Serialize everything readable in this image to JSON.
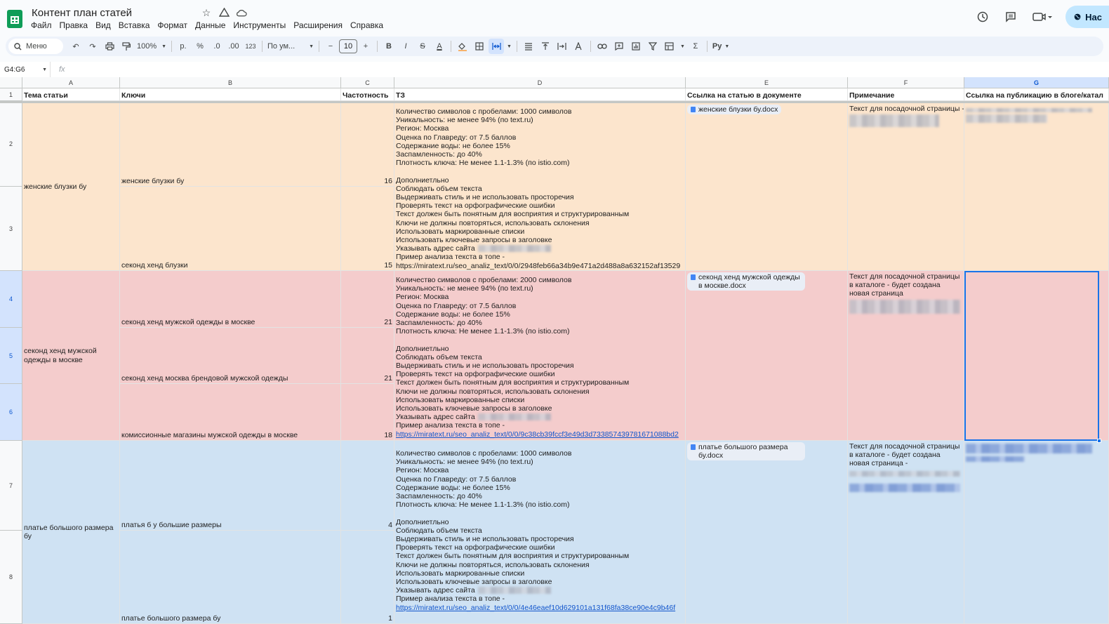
{
  "app": {
    "title": "Контент план статей",
    "menu": [
      "Файл",
      "Правка",
      "Вид",
      "Вставка",
      "Формат",
      "Данные",
      "Инструменты",
      "Расширения",
      "Справка"
    ],
    "share_label": "Нас"
  },
  "toolbar": {
    "search_label": "Меню",
    "zoom": "100%",
    "currency": "р.",
    "percent": "%",
    "dec_decrease": ".0",
    "dec_increase": ".00",
    "number_format": "123",
    "font": "По ум...",
    "font_size": "10",
    "bold": "B",
    "italic": "I",
    "strike": "S",
    "text_color": "A",
    "sum": "Σ",
    "input_tools": "Ру"
  },
  "formula": {
    "namebox": "G4:G6",
    "fx": "fx"
  },
  "columns": [
    "A",
    "B",
    "C",
    "D",
    "E",
    "F",
    "G"
  ],
  "rows": [
    "1",
    "2",
    "3",
    "4",
    "5",
    "6",
    "7",
    "8"
  ],
  "header_row": {
    "a": "Тема статьи",
    "b": "Ключи",
    "c": "Частотность",
    "d": "ТЗ",
    "e": "Ссылка на статью в документе",
    "f": "Примечание",
    "g": "Ссылка на публикацию в блоге/катал"
  },
  "groups": [
    {
      "topic": "женские блузки бу",
      "keys": [
        {
          "key": "женские блузки бу",
          "freq": "16"
        },
        {
          "key": "секонд хенд блузки",
          "freq": "15"
        }
      ],
      "tz": [
        "Количество символов с пробелами: 1000 символов",
        "Уникальность: не менее 94% (по text.ru)",
        "Регион: Москва",
        "Оценка по Главреду: от 7.5 баллов",
        "Содержание воды: не более 15%",
        "Заспамленность: до 40%",
        "Плотность ключа: Не менее 1.1-1.3% (по istio.com)",
        "",
        "Дополниетльно",
        "Соблюдать объем текста",
        "Выдерживать стиль и не использовать просторечия",
        "Проверять текст на орфографические ошибки",
        "Текст должен быть понятным для восприятия и структурированным",
        "Ключи не должны повторяться, использовать склонения",
        "Использовать маркированные списки",
        "Использовать ключевые запросы в заголовке",
        "Указывать адрес сайта",
        "Пример анализа текста в топе -"
      ],
      "tz_link": "https://miratext.ru/seo_analiz_text/0/0/2948feb66a34b9e471a2d488a8a632152af13529",
      "doc": "женские блузки бу.docx",
      "note": "Текст для посадочной страницы -"
    },
    {
      "topic": "секонд хенд мужской одежды в москве",
      "keys": [
        {
          "key": "секонд хенд мужской одежды в москве",
          "freq": "21"
        },
        {
          "key": "секонд хенд москва брендовой мужской одежды",
          "freq": "21"
        },
        {
          "key": "комиссионные магазины мужской одежды в москве",
          "freq": "18"
        }
      ],
      "tz": [
        "Количество символов с пробелами: 2000 символов",
        "Уникальность: не менее 94% (по text.ru)",
        "Регион: Москва",
        "Оценка по Главреду: от 7.5 баллов",
        "Содержание воды: не более 15%",
        "Заспамленность: до 40%",
        "Плотность ключа: Не менее 1.1-1.3% (по istio.com)",
        "",
        "Дополниетльно",
        "Соблюдать объем текста",
        "Выдерживать стиль и не использовать просторечия",
        "Проверять текст на орфографические ошибки",
        "Текст должен быть понятным для восприятия и структурированным",
        "Ключи не должны повторяться, использовать склонения",
        "Использовать маркированные списки",
        "Использовать ключевые запросы в заголовке",
        "Указывать адрес сайта",
        "Пример анализа текста в топе -"
      ],
      "tz_link": "https://miratext.ru/seo_analiz_text/0/0/9c38cb39fccf3e49d3d733857439781671088bd2",
      "doc": "секонд хенд мужской одежды в москве.docx",
      "note": "Текст для посадочной страницы в каталоге - будет создана новая страница"
    },
    {
      "topic": "платье большого размера бу",
      "keys": [
        {
          "key": "платья б у большие размеры",
          "freq": "4"
        },
        {
          "key": "платье большого размера бу",
          "freq": "1"
        }
      ],
      "tz": [
        "Количество символов с пробелами: 1000 символов",
        "Уникальность: не менее 94% (по text.ru)",
        "Регион: Москва",
        "Оценка по Главреду: от 7.5 баллов",
        "Содержание воды: не более 15%",
        "Заспамленность: до 40%",
        "Плотность ключа: Не менее 1.1-1.3% (по istio.com)",
        "",
        "Дополниетльно",
        "Соблюдать объем текста",
        "Выдерживать стиль и не использовать просторечия",
        "Проверять текст на орфографические ошибки",
        "Текст должен быть понятным для восприятия и структурированным",
        "Ключи не должны повторяться, использовать склонения",
        "Использовать маркированные списки",
        "Использовать ключевые запросы в заголовке",
        "Указывать адрес сайта",
        "Пример анализа текста в топе -"
      ],
      "tz_link": "https://miratext.ru/seo_analiz_text/0/0/4e46eaef10d629101a131f68fa38ce90e4c9b46f",
      "doc": "платье большого размера бу.docx",
      "note": "Текст для посадочной страницы в каталоге - будет создана новая страница  -"
    }
  ],
  "colors": {
    "orange": "#fce5cd",
    "red": "#f4cccc",
    "blue": "#cfe2f3",
    "selection": "#1a73e8",
    "link": "#1155cc"
  }
}
